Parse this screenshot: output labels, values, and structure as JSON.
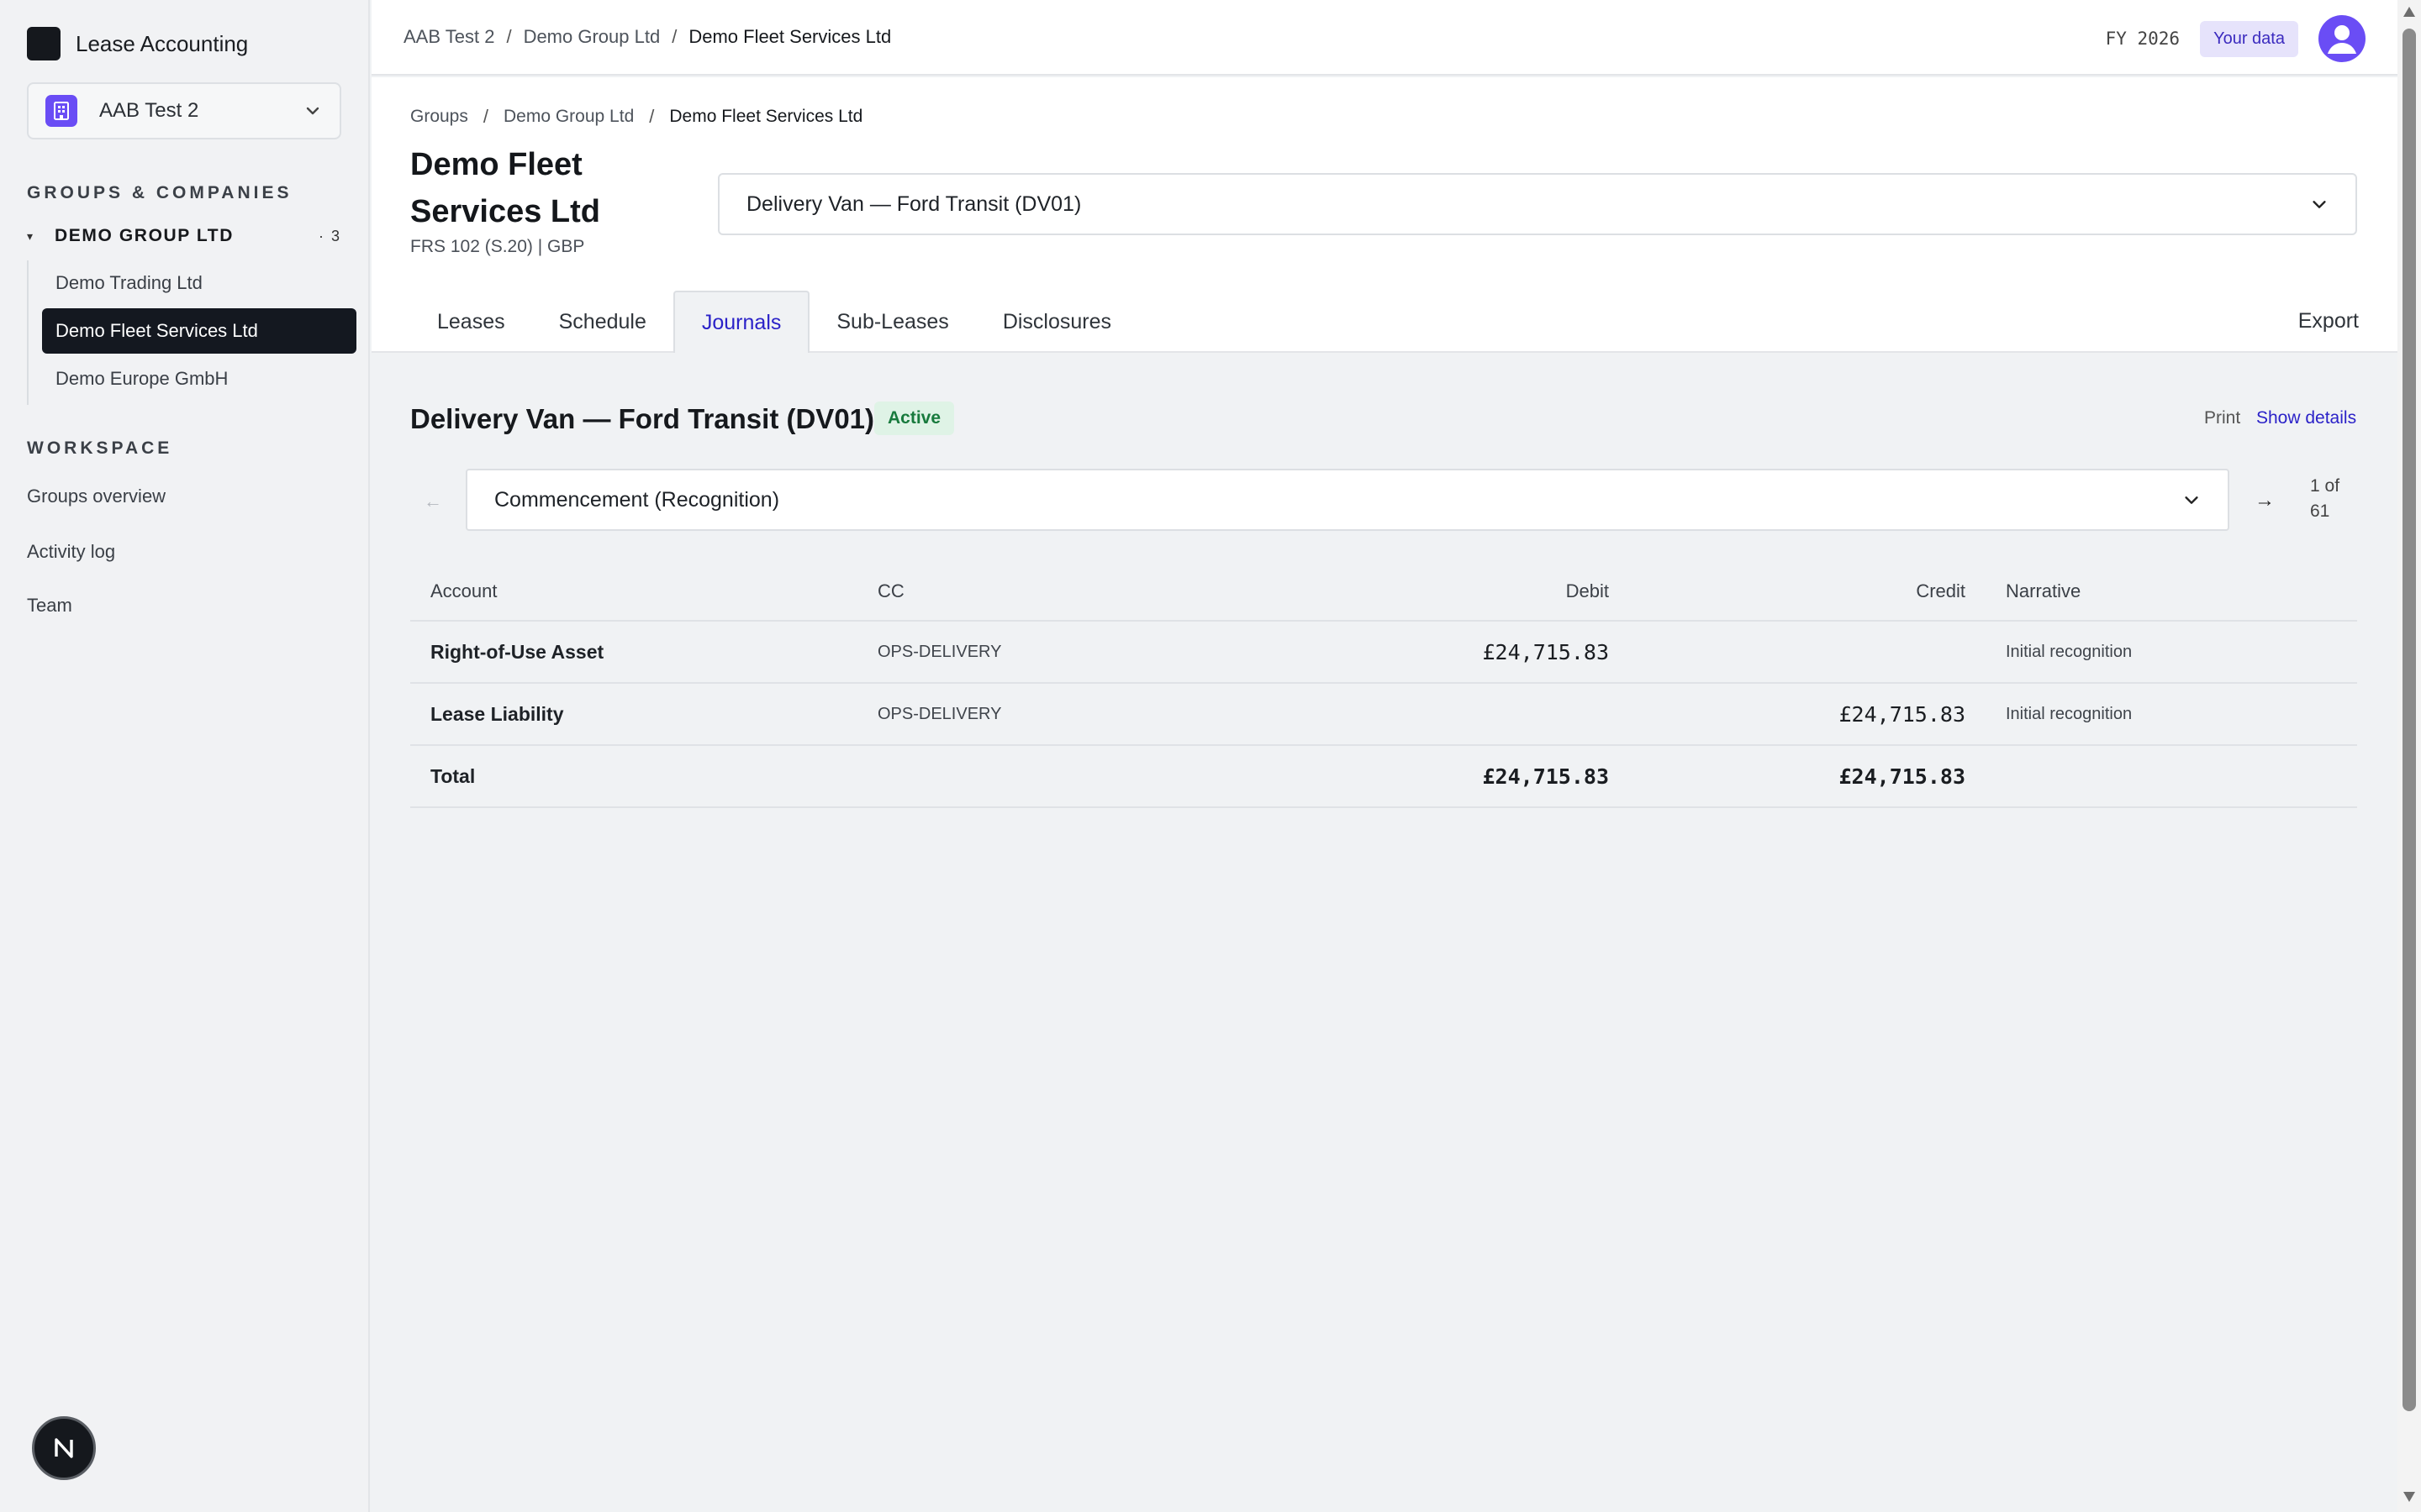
{
  "app": {
    "name": "Lease Accounting"
  },
  "workspace": {
    "name": "AAB Test 2"
  },
  "sidebar": {
    "groups_label": "GROUPS & COMPANIES",
    "group": {
      "name": "DEMO GROUP LTD",
      "count": "· 3",
      "companies": [
        {
          "label": "Demo Trading Ltd"
        },
        {
          "label": "Demo Fleet Services Ltd"
        },
        {
          "label": "Demo Europe GmbH"
        }
      ]
    },
    "workspace_label": "WORKSPACE",
    "nav": [
      {
        "label": "Groups overview"
      },
      {
        "label": "Activity log"
      },
      {
        "label": "Team"
      }
    ]
  },
  "topbar": {
    "breadcrumb": [
      "AAB Test 2",
      "Demo Group Ltd",
      "Demo Fleet Services Ltd"
    ],
    "fiscal_year": "FY 2026",
    "your_data": "Your data"
  },
  "header": {
    "breadcrumb": [
      "Groups",
      "Demo Group Ltd",
      "Demo Fleet Services Ltd"
    ],
    "title": "Demo Fleet Services Ltd",
    "subtitle": "FRS 102 (S.20) | GBP",
    "lease_select": "Delivery Van — Ford Transit (DV01)",
    "tabs": [
      {
        "label": "Leases"
      },
      {
        "label": "Schedule"
      },
      {
        "label": "Journals"
      },
      {
        "label": "Sub-Leases"
      },
      {
        "label": "Disclosures"
      }
    ],
    "export": "Export"
  },
  "journal": {
    "title": "Delivery Van — Ford Transit (DV01)",
    "status": "Active",
    "print": "Print",
    "show_details": "Show details",
    "entry_select": "Commencement (Recognition)",
    "pager_line1": "1 of",
    "pager_line2": "61",
    "columns": {
      "account": "Account",
      "cc": "CC",
      "debit": "Debit",
      "credit": "Credit",
      "narrative": "Narrative"
    },
    "rows": [
      {
        "account": "Right-of-Use Asset",
        "cc": "OPS-DELIVERY",
        "debit": "£24,715.83",
        "credit": "",
        "narrative": "Initial recognition"
      },
      {
        "account": "Lease Liability",
        "cc": "OPS-DELIVERY",
        "debit": "",
        "credit": "£24,715.83",
        "narrative": "Initial recognition"
      }
    ],
    "total": {
      "label": "Total",
      "debit": "£24,715.83",
      "credit": "£24,715.83"
    }
  },
  "help_button": "N",
  "colors": {
    "accent": "#6a4df5",
    "link": "#2b22c8",
    "active_nav": "#141820",
    "status_bg": "#dff3e6",
    "status_fg": "#187a3d"
  }
}
